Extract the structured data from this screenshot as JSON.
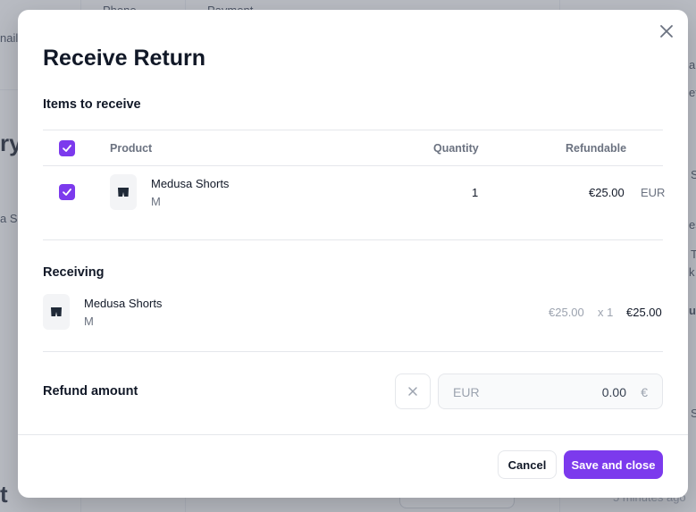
{
  "background": {
    "col_phone": "Phone",
    "col_payment": "Payment",
    "email_fragment": "nail.",
    "heading_fragment": "ry",
    "item_fragment": "a Sh",
    "bottom_heading_fragment": "t",
    "right_time": "5 minutes ago",
    "right_fragments": [
      "a",
      "et",
      "S",
      "es",
      "T",
      "k",
      "ur",
      "S"
    ]
  },
  "modal": {
    "title": "Receive Return",
    "items_section": {
      "heading": "Items to receive",
      "columns": {
        "product": "Product",
        "quantity": "Quantity",
        "refundable": "Refundable"
      },
      "rows": [
        {
          "checked": true,
          "name": "Medusa Shorts",
          "variant": "M",
          "quantity": "1",
          "refundable": "€25.00",
          "currency": "EUR"
        }
      ]
    },
    "receiving_section": {
      "heading": "Receiving",
      "items": [
        {
          "name": "Medusa Shorts",
          "variant": "M",
          "unit_price": "€25.00",
          "qty": "x 1",
          "total": "€25.00"
        }
      ]
    },
    "refund": {
      "label": "Refund amount",
      "currency_code": "EUR",
      "amount": "0.00",
      "symbol": "€"
    },
    "footer": {
      "cancel_label": "Cancel",
      "save_label": "Save and close"
    }
  },
  "colors": {
    "accent": "#7c3aed",
    "overlay": "rgba(107,114,128,0.45)"
  }
}
